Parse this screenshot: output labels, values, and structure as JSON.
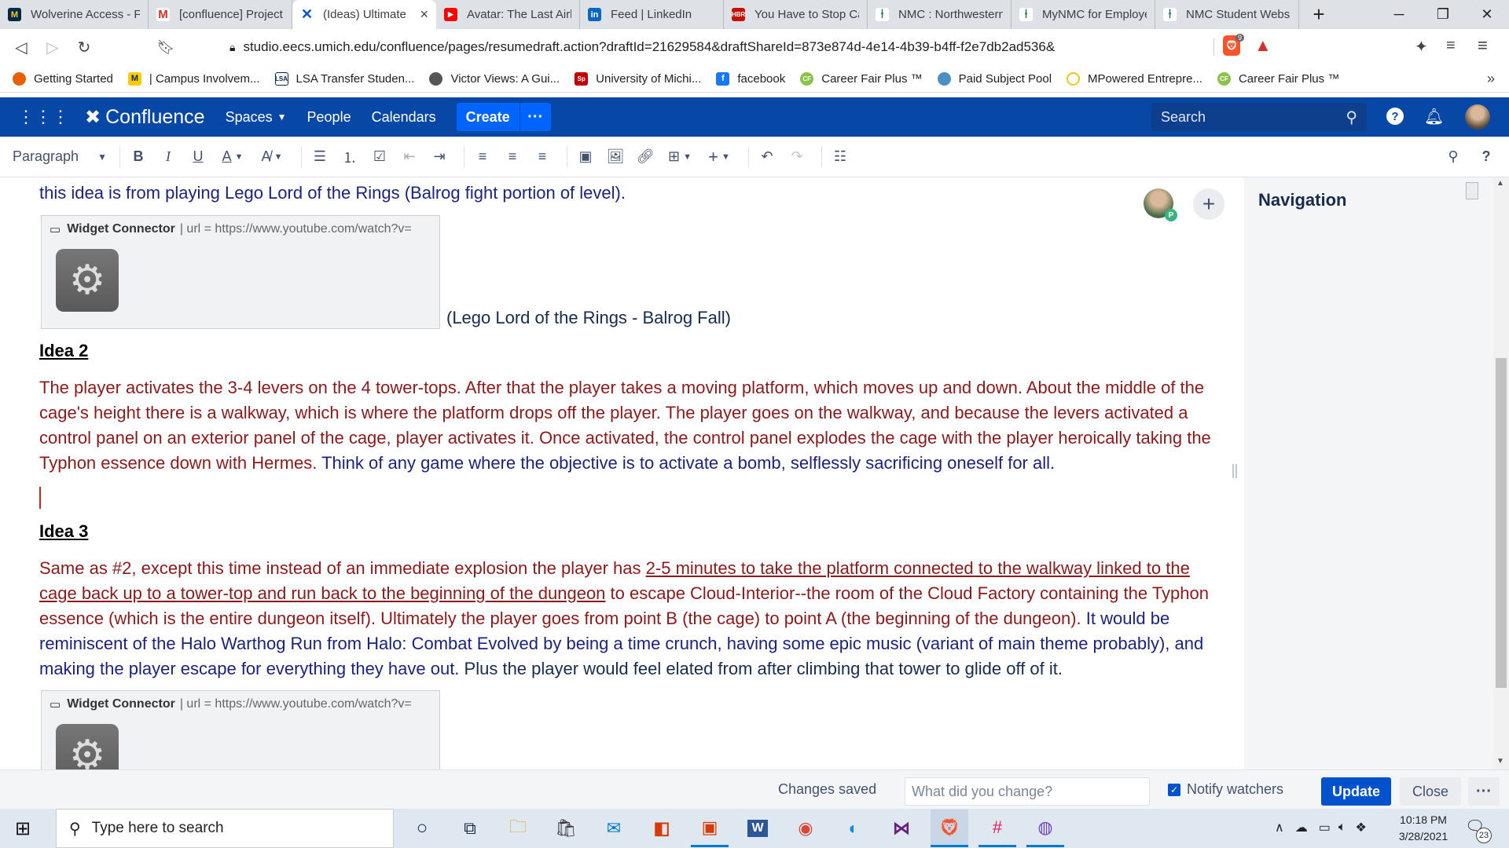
{
  "browser": {
    "tabs": [
      {
        "title": "Wolverine Access - F",
        "icon": "umich-icon",
        "color": "#ffcb05"
      },
      {
        "title": "[confluence] Project",
        "icon": "gmail-icon",
        "color": "#d93025"
      },
      {
        "title": "(Ideas) Ultimate",
        "icon": "confluence-icon",
        "color": "#0052cc",
        "active": true
      },
      {
        "title": "Avatar: The Last Airb",
        "icon": "youtube-icon",
        "color": "#ff0000"
      },
      {
        "title": "Feed | LinkedIn",
        "icon": "linkedin-icon",
        "color": "#0a66c2"
      },
      {
        "title": "You Have to Stop Ca",
        "icon": "hbr-icon",
        "color": "#c41200"
      },
      {
        "title": "NMC : Northwestern",
        "icon": "nmc-icon",
        "color": "#2e7d5b"
      },
      {
        "title": "MyNMC for Employe",
        "icon": "nmc-icon",
        "color": "#2e7d5b"
      },
      {
        "title": "NMC Student Websi",
        "icon": "nmc-icon",
        "color": "#2e7d5b"
      }
    ],
    "url": "studio.eecs.umich.edu/confluence/pages/resumedraft.action?draftId=21629584&draftShareId=873e874d-4e14-4b39-b4ff-f2e7db2ad536&",
    "brave_badge": "9",
    "bookmarks": [
      {
        "label": "Getting Started",
        "icon": "firefox-icon",
        "color": "#e66000"
      },
      {
        "label": "| Campus Involvem...",
        "icon": "umich-icon",
        "color": "#ffcb05"
      },
      {
        "label": "LSA Transfer Studen...",
        "icon": "lsa-icon",
        "color": "#00274c"
      },
      {
        "label": "Victor Views: A Gui...",
        "icon": "victor-icon",
        "color": "#555555"
      },
      {
        "label": "University of Michi...",
        "icon": "sp-icon",
        "color": "#c00000"
      },
      {
        "label": "facebook",
        "icon": "facebook-icon",
        "color": "#1877f2"
      },
      {
        "label": "Career Fair Plus ™",
        "icon": "cf-icon",
        "color": "#8bc34a"
      },
      {
        "label": "Paid Subject Pool",
        "icon": "subject-pool-icon",
        "color": "#4a90c2"
      },
      {
        "label": "MPowered Entrepre...",
        "icon": "mpowered-icon",
        "color": "#f5c518"
      },
      {
        "label": "Career Fair Plus ™",
        "icon": "cf-icon",
        "color": "#8bc34a"
      }
    ]
  },
  "confluence": {
    "brand": "Confluence",
    "nav": [
      "Spaces",
      "People",
      "Calendars"
    ],
    "create": "Create",
    "search_placeholder": "Search",
    "toolbar": {
      "paragraph": "Paragraph"
    }
  },
  "content": {
    "intro_line": "this idea is from playing Lego Lord of the Rings (Balrog fight portion of level).",
    "widget_title": "Widget Connector",
    "widget_url": "| url = https://www.youtube.com/watch?v=",
    "widget_caption": "(Lego Lord of the Rings - Balrog Fall)",
    "idea2_heading": "Idea 2",
    "idea2_red": "The player activates the 3-4 levers on the 4 tower-tops. After that the player takes a moving platform, which moves up and down. About the middle of the cage's height there is a walkway, which is where the platform drops off the player. The player goes on the walkway, and because the levers activated a control panel on an exterior panel of the cage, player activates it. Once activated, the control panel explodes the cage with the player heroically taking the Typhon essence down with Hermes.",
    "idea2_blue": " Think of any game where the objective is to activate a bomb, selflessly sacrificing oneself for all.",
    "idea3_heading": "Idea 3",
    "idea3_red1": "Same as #2, except this time instead of an immediate explosion the player has ",
    "idea3_underline": "2-5 minutes to take the platform connected to the walkway linked to the cage back up to a tower-top and run back to the beginning of the dungeon",
    "idea3_red2": " to escape Cloud-Interior--the room of the Cloud Factory containing the Typhon essence (which is the entire dungeon itself). Ultimately the player goes from point B (the cage) to point A (the beginning of the dungeon).",
    "idea3_blue": " It would be reminiscent of the Halo Warthog Run from Halo: Combat Evolved by being a time crunch, having some epic music (variant of main theme probably), and making the player escape for everything they have out.",
    "idea3_black": " Plus the player would feel elated from after climbing that tower to glide off of it."
  },
  "sidebar": {
    "title": "Navigation",
    "avatar_badge": "P"
  },
  "footer": {
    "status": "Changes saved",
    "comment_placeholder": "What did you change?",
    "notify": "Notify watchers",
    "update": "Update",
    "close": "Close"
  },
  "taskbar": {
    "search_placeholder": "Type here to search",
    "time": "10:18 PM",
    "date": "3/28/2021",
    "notifications": "23"
  }
}
